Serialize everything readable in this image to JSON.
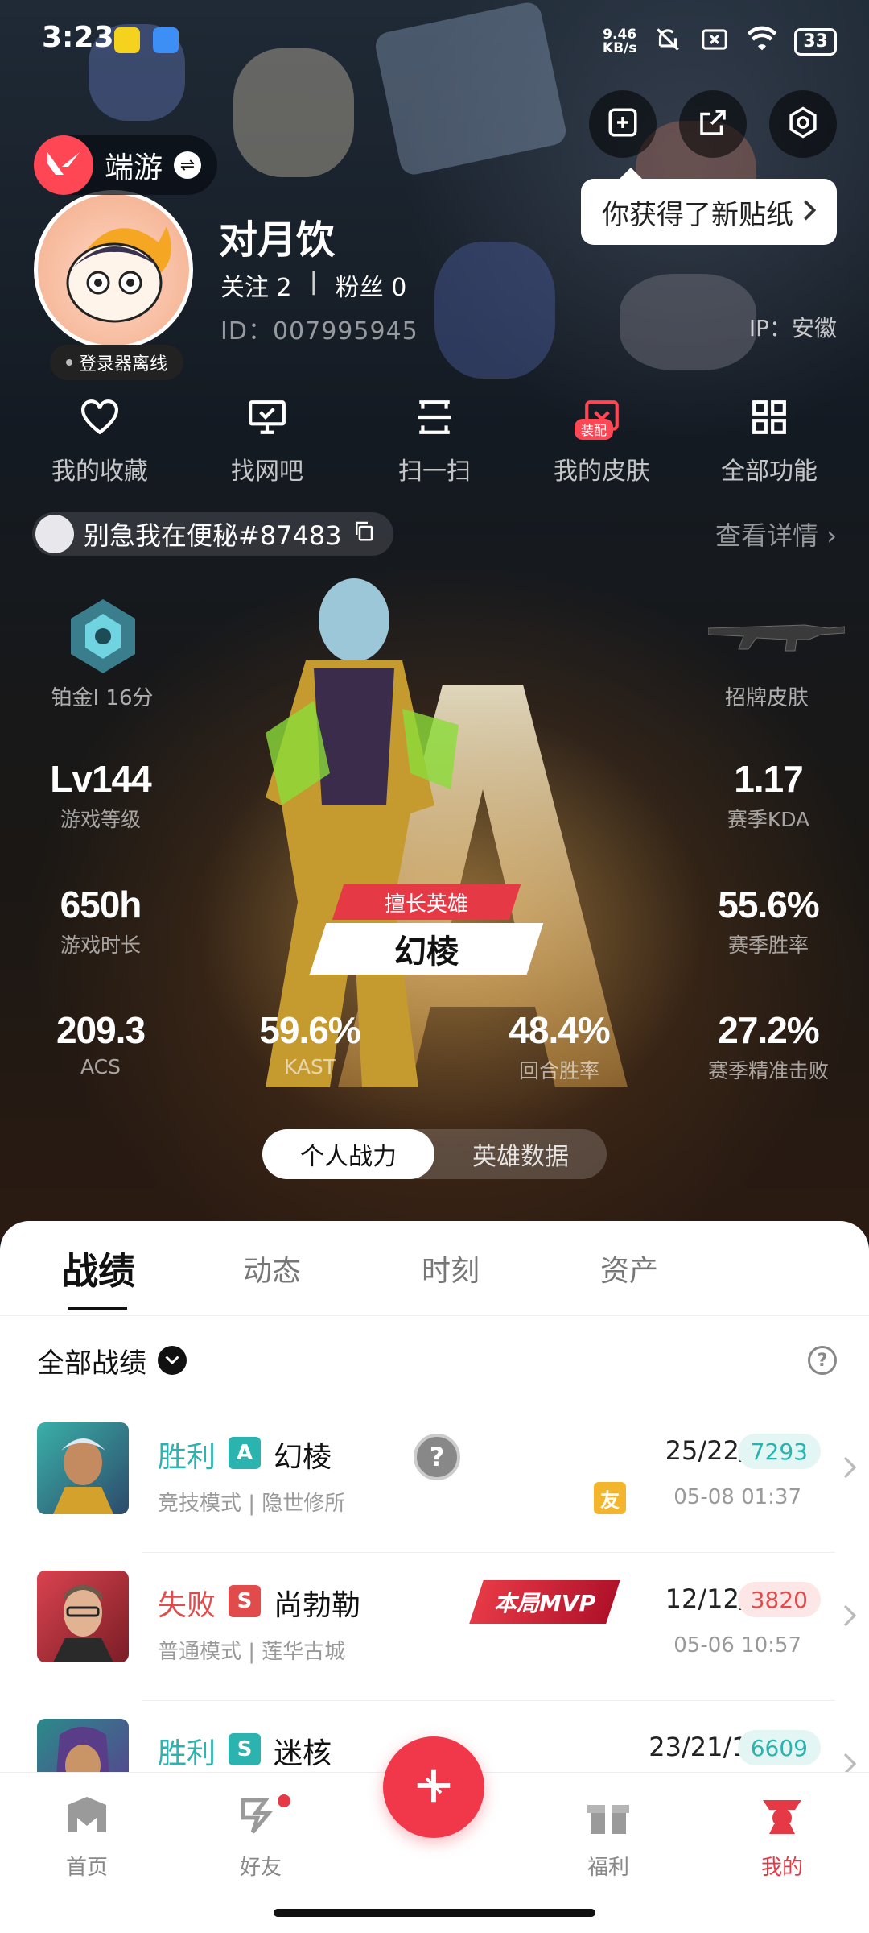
{
  "status_bar": {
    "time": "3:23",
    "speed_value": "9.46",
    "speed_unit": "KB/s",
    "battery": "33"
  },
  "profile": {
    "game_name": "端游",
    "username": "对月饮",
    "following_label": "关注",
    "following_count": "2",
    "fans_label": "粉丝",
    "fans_count": "0",
    "id_text": "ID：007995945",
    "ip_text": "IP：安徽",
    "login_status": "登录器离线",
    "sticker_toast": "你获得了新贴纸"
  },
  "quick_actions": [
    {
      "label": "我的收藏",
      "icon": "heart-icon"
    },
    {
      "label": "找网吧",
      "icon": "monitor-icon"
    },
    {
      "label": "扫一扫",
      "icon": "scan-icon"
    },
    {
      "label": "我的皮肤",
      "icon": "skin-icon",
      "badge": "装配"
    },
    {
      "label": "全部功能",
      "icon": "grid-icon"
    }
  ],
  "game_account": {
    "riot_id": "别急我在便秘#87483",
    "details_link": "查看详情",
    "rank": "铂金I 16分",
    "signature_skin": "招牌皮肤"
  },
  "stats": {
    "level": {
      "value": "Lv144",
      "label": "游戏等级"
    },
    "kda": {
      "value": "1.17",
      "label": "赛季KDA"
    },
    "hours": {
      "value": "650h",
      "label": "游戏时长"
    },
    "winrate": {
      "value": "55.6%",
      "label": "赛季胜率"
    },
    "acs": {
      "value": "209.3",
      "label": "ACS"
    },
    "kast": {
      "value": "59.6%",
      "label": "KAST"
    },
    "round_win": {
      "value": "48.4%",
      "label": "回合胜率"
    },
    "precision": {
      "value": "27.2%",
      "label": "赛季精准击败"
    }
  },
  "best_hero": {
    "tag": "擅长英雄",
    "name": "幻棱",
    "letter": "A"
  },
  "segment": {
    "left": "个人战力",
    "right": "英雄数据",
    "active": "left"
  },
  "tabs": [
    "战绩",
    "动态",
    "时刻",
    "资产"
  ],
  "filter": {
    "label": "全部战绩"
  },
  "matches": [
    {
      "result": "胜利",
      "win": true,
      "grade": "A",
      "agent": "幻棱",
      "mode": "竞技模式 | 隐世修所",
      "kda": "25/22/7",
      "score": "7293",
      "time": "05-08 01:37",
      "friend": "友",
      "mvp": ""
    },
    {
      "result": "失败",
      "win": false,
      "grade": "S",
      "agent": "尚勃勒",
      "mode": "普通模式 | 莲华古城",
      "kda": "12/12/2",
      "score": "3820",
      "time": "05-06 10:57",
      "friend": "",
      "mvp": "本局MVP"
    },
    {
      "result": "胜利",
      "win": true,
      "grade": "S",
      "agent": "迷核",
      "mode": "",
      "kda": "23/21/11",
      "score": "6609",
      "time": "",
      "friend": "",
      "mvp": ""
    }
  ],
  "bottom_nav": [
    {
      "label": "首页"
    },
    {
      "label": "好友"
    },
    {
      "label": "福利"
    },
    {
      "label": "我的"
    }
  ],
  "colors": {
    "accent": "#e63946",
    "win": "#2bb3b0",
    "loss": "#e14b4b",
    "win_score_bg": "#e3f6f4",
    "loss_score_bg": "#fde6e6"
  }
}
